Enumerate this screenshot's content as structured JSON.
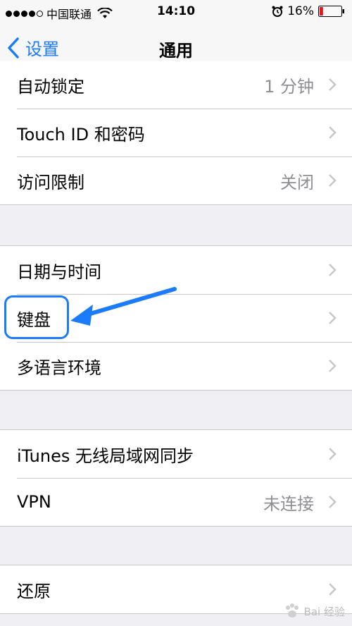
{
  "status_bar": {
    "carrier": "中国联通",
    "time": "14:10",
    "battery": "16%",
    "icons": [
      "signal-icon",
      "wifi-icon",
      "alarm-icon",
      "battery-icon"
    ]
  },
  "nav": {
    "back_label": "设置",
    "title": "通用"
  },
  "groups": [
    {
      "rows": [
        {
          "label": "自动锁定",
          "value": "1 分钟"
        },
        {
          "label": "Touch ID 和密码",
          "value": ""
        },
        {
          "label": "访问限制",
          "value": "关闭"
        }
      ]
    },
    {
      "rows": [
        {
          "label": "日期与时间",
          "value": ""
        },
        {
          "label": "键盘",
          "value": ""
        },
        {
          "label": "多语言环境",
          "value": ""
        }
      ]
    },
    {
      "rows": [
        {
          "label": "iTunes 无线局域网同步",
          "value": ""
        },
        {
          "label": "VPN",
          "value": "未连接"
        }
      ]
    },
    {
      "rows": [
        {
          "label": "还原",
          "value": ""
        }
      ]
    }
  ],
  "watermark": {
    "text": "Bai 经验"
  },
  "colors": {
    "accent": "#1a7cfa",
    "battery_low": "#e0191b"
  }
}
